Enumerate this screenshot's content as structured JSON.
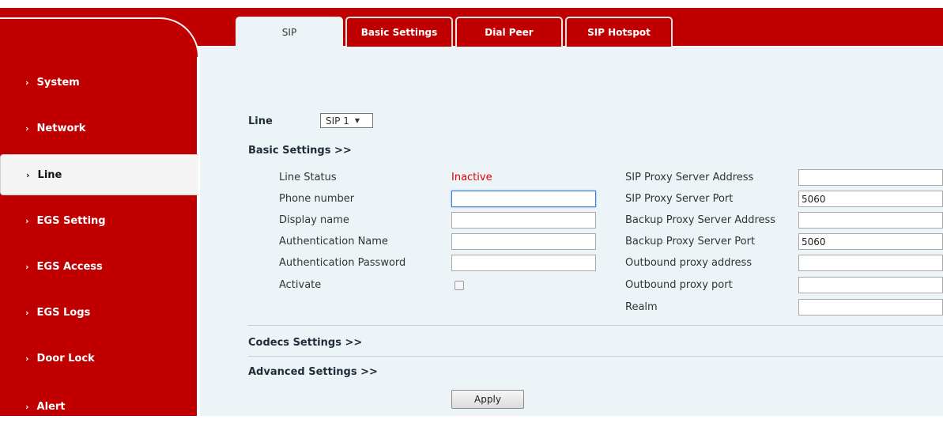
{
  "sidebar": {
    "items": [
      {
        "label": "System"
      },
      {
        "label": "Network"
      },
      {
        "label": "Line"
      },
      {
        "label": "EGS Setting"
      },
      {
        "label": "EGS Access"
      },
      {
        "label": "EGS Logs"
      },
      {
        "label": "Door Lock"
      },
      {
        "label": "Alert"
      }
    ],
    "chevron": "›",
    "active_index": 2
  },
  "tabs": [
    {
      "label": "SIP"
    },
    {
      "label": "Basic Settings"
    },
    {
      "label": "Dial Peer"
    },
    {
      "label": "SIP Hotspot"
    }
  ],
  "line_select": {
    "label": "Line",
    "value": "SIP 1",
    "arrow": "▼"
  },
  "basic_settings": {
    "header": "Basic Settings >>",
    "line_status_label": "Line Status",
    "line_status_value": "Inactive",
    "phone_number_label": "Phone number",
    "phone_number_value": "",
    "display_name_label": "Display name",
    "display_name_value": "",
    "auth_name_label": "Authentication Name",
    "auth_name_value": "",
    "auth_password_label": "Authentication Password",
    "auth_password_value": "",
    "activate_label": "Activate",
    "activate_checked": false,
    "sip_proxy_address_label": "SIP Proxy Server Address",
    "sip_proxy_address_value": "",
    "sip_proxy_port_label": "SIP Proxy Server Port",
    "sip_proxy_port_value": "5060",
    "backup_proxy_address_label": "Backup Proxy Server Address",
    "backup_proxy_address_value": "",
    "backup_proxy_port_label": "Backup Proxy Server Port",
    "backup_proxy_port_value": "5060",
    "outbound_proxy_address_label": "Outbound proxy address",
    "outbound_proxy_address_value": "",
    "outbound_proxy_port_label": "Outbound proxy port",
    "outbound_proxy_port_value": "",
    "realm_label": "Realm",
    "realm_value": ""
  },
  "codecs_settings": {
    "header": "Codecs Settings >>"
  },
  "advanced_settings": {
    "header": "Advanced Settings >>"
  },
  "apply_label": "Apply",
  "colors": {
    "brand_red": "#c00000",
    "inactive_red": "#e00000",
    "content_bg": "#edf4f7"
  }
}
